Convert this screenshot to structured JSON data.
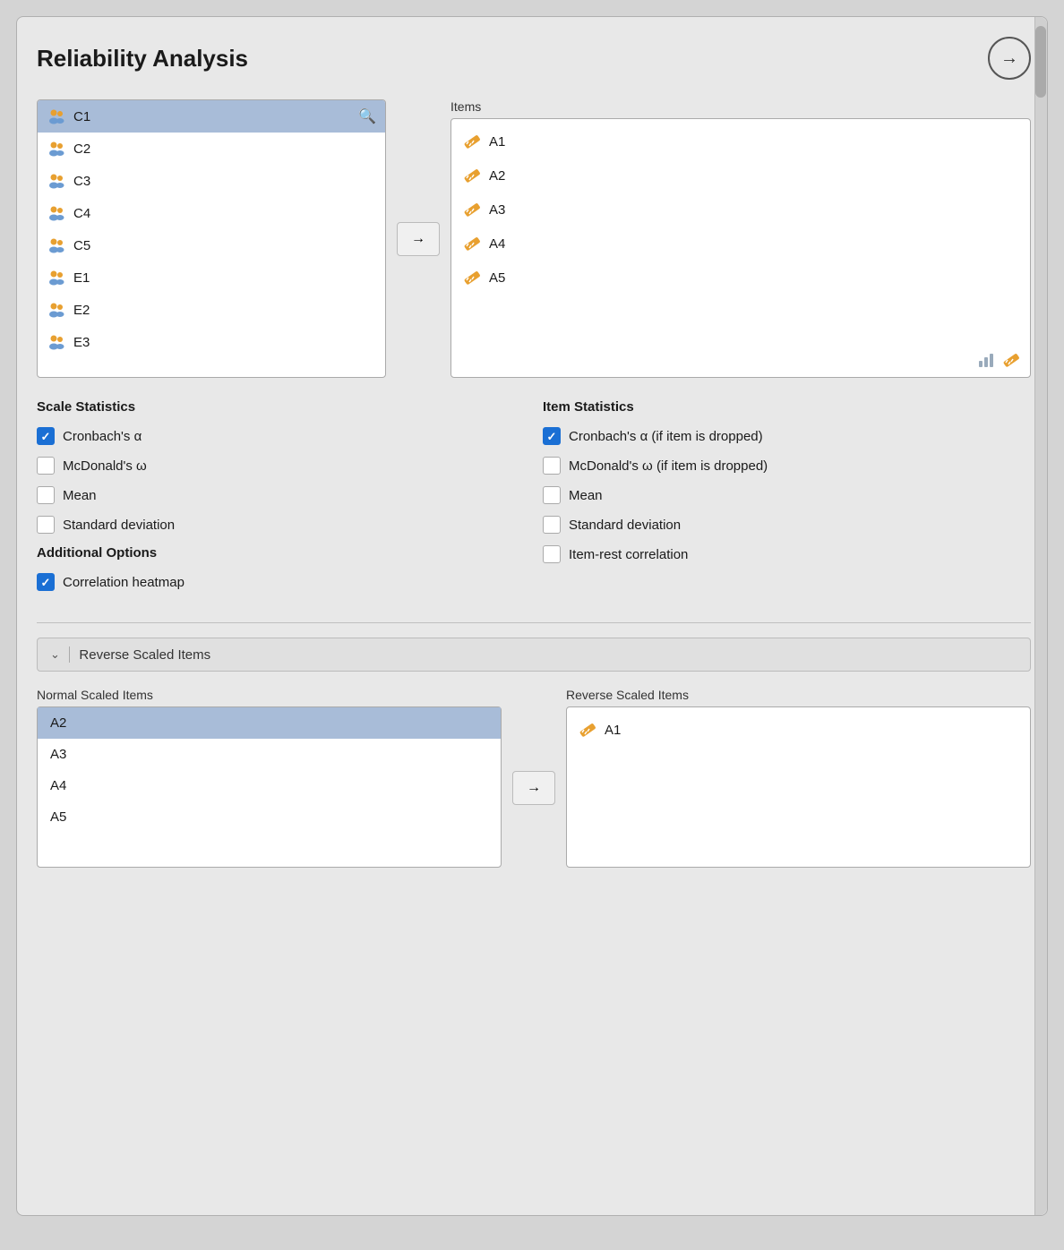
{
  "header": {
    "title": "Reliability Analysis",
    "arrow_btn_label": "→"
  },
  "variable_list": {
    "items": [
      {
        "id": "C1",
        "selected": true
      },
      {
        "id": "C2"
      },
      {
        "id": "C3"
      },
      {
        "id": "C4"
      },
      {
        "id": "C5"
      },
      {
        "id": "E1"
      },
      {
        "id": "E2"
      },
      {
        "id": "E3"
      }
    ]
  },
  "transfer_btn": "→",
  "items_panel": {
    "label": "Items",
    "items": [
      {
        "id": "A1"
      },
      {
        "id": "A2"
      },
      {
        "id": "A3"
      },
      {
        "id": "A4"
      },
      {
        "id": "A5"
      }
    ]
  },
  "scale_statistics": {
    "heading": "Scale Statistics",
    "options": [
      {
        "label": "Cronbach's α",
        "checked": true
      },
      {
        "label": "McDonald's ω",
        "checked": false
      },
      {
        "label": "Mean",
        "checked": false
      },
      {
        "label": "Standard deviation",
        "checked": false
      }
    ]
  },
  "item_statistics": {
    "heading": "Item Statistics",
    "options": [
      {
        "label": "Cronbach's α (if item is dropped)",
        "checked": true
      },
      {
        "label": "McDonald's ω (if item is dropped)",
        "checked": false
      },
      {
        "label": "Mean",
        "checked": false
      },
      {
        "label": "Standard deviation",
        "checked": false
      },
      {
        "label": "Item-rest correlation",
        "checked": false
      }
    ]
  },
  "additional_options": {
    "heading": "Additional Options",
    "options": [
      {
        "label": "Correlation heatmap",
        "checked": true
      }
    ]
  },
  "reverse_scaled": {
    "header_label": "Reverse Scaled Items",
    "normal_label": "Normal Scaled Items",
    "reverse_label": "Reverse Scaled Items",
    "normal_items": [
      {
        "id": "A2",
        "selected": true
      },
      {
        "id": "A3"
      },
      {
        "id": "A4"
      },
      {
        "id": "A5"
      }
    ],
    "reverse_items": [
      {
        "id": "A1"
      }
    ]
  }
}
